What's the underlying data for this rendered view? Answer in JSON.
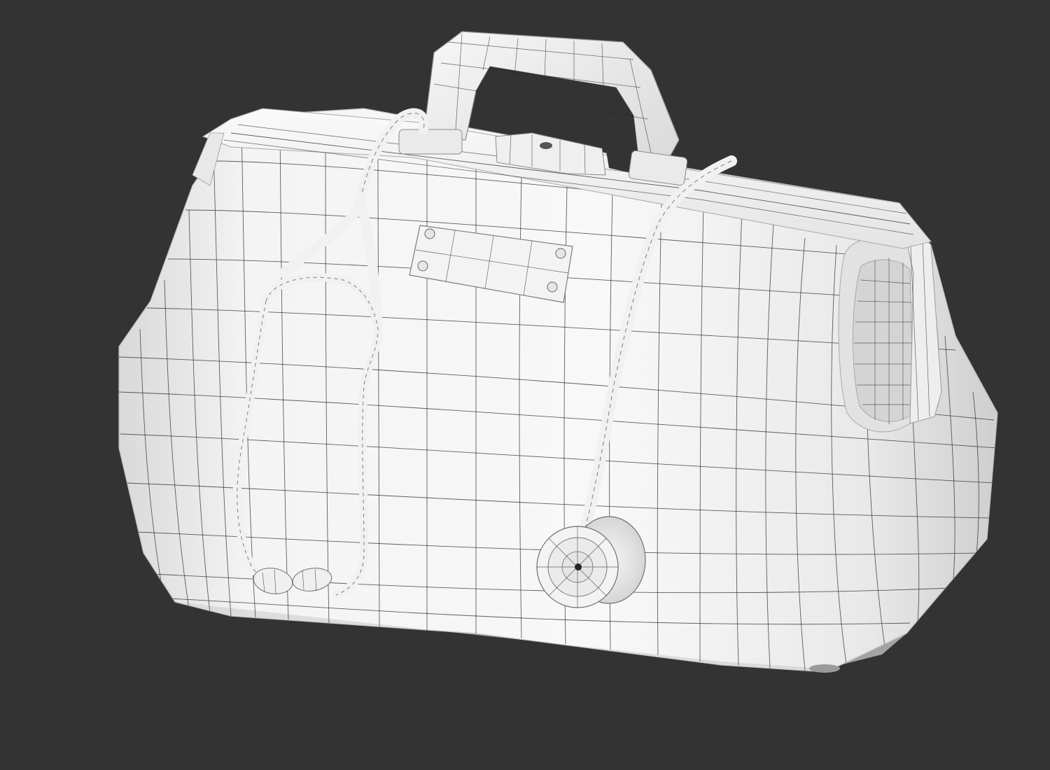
{
  "scene": {
    "subject": "wireframe-doctor-bag-with-stethoscope",
    "background_color": "#333333",
    "shading": "clay-white-with-wireframe",
    "surface_color": "#f1f1f1",
    "shadow_color": "#cfcfcf",
    "wire_color": "#2a2a2a"
  },
  "objects": [
    {
      "name": "doctor-bag",
      "parts": [
        "body",
        "top-frame",
        "handle",
        "clasp",
        "name-plate",
        "side-opening"
      ]
    },
    {
      "name": "stethoscope",
      "parts": [
        "tubing",
        "binaural-y",
        "earpieces",
        "chest-piece"
      ]
    }
  ]
}
